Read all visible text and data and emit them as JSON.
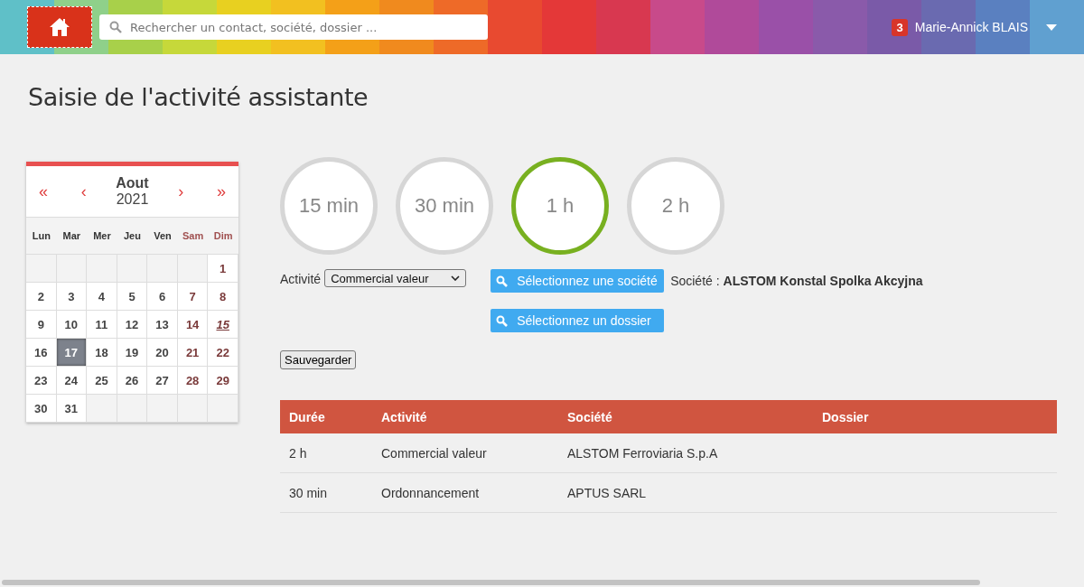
{
  "header": {
    "search": {
      "placeholder": "Rechercher un contact, société, dossier ..."
    },
    "user": {
      "badge": "3",
      "name": "Marie-Annick BLAIS"
    }
  },
  "page_title": "Saisie de l'activité assistante",
  "calendar": {
    "nav": [
      "«",
      "‹",
      "›",
      "»"
    ],
    "month": "Aout",
    "year": "2021",
    "weekdays": [
      {
        "label": "Lun",
        "weekend": false
      },
      {
        "label": "Mar",
        "weekend": false
      },
      {
        "label": "Mer",
        "weekend": false
      },
      {
        "label": "Jeu",
        "weekend": false
      },
      {
        "label": "Ven",
        "weekend": false
      },
      {
        "label": "Sam",
        "weekend": true
      },
      {
        "label": "Dim",
        "weekend": true
      }
    ],
    "weeks": [
      [
        {
          "kind": "empty"
        },
        {
          "kind": "empty"
        },
        {
          "kind": "empty"
        },
        {
          "kind": "empty"
        },
        {
          "kind": "empty"
        },
        {
          "kind": "empty"
        },
        {
          "kind": "day",
          "day": "1",
          "weekend": true,
          "holiday": false,
          "selected": false
        }
      ],
      [
        {
          "kind": "day",
          "day": "2",
          "weekend": false,
          "holiday": false,
          "selected": false
        },
        {
          "kind": "day",
          "day": "3",
          "weekend": false,
          "holiday": false,
          "selected": false
        },
        {
          "kind": "day",
          "day": "4",
          "weekend": false,
          "holiday": false,
          "selected": false
        },
        {
          "kind": "day",
          "day": "5",
          "weekend": false,
          "holiday": false,
          "selected": false
        },
        {
          "kind": "day",
          "day": "6",
          "weekend": false,
          "holiday": false,
          "selected": false
        },
        {
          "kind": "day",
          "day": "7",
          "weekend": true,
          "holiday": false,
          "selected": false
        },
        {
          "kind": "day",
          "day": "8",
          "weekend": true,
          "holiday": false,
          "selected": false
        }
      ],
      [
        {
          "kind": "day",
          "day": "9",
          "weekend": false,
          "holiday": false,
          "selected": false
        },
        {
          "kind": "day",
          "day": "10",
          "weekend": false,
          "holiday": false,
          "selected": false
        },
        {
          "kind": "day",
          "day": "11",
          "weekend": false,
          "holiday": false,
          "selected": false
        },
        {
          "kind": "day",
          "day": "12",
          "weekend": false,
          "holiday": false,
          "selected": false
        },
        {
          "kind": "day",
          "day": "13",
          "weekend": false,
          "holiday": false,
          "selected": false
        },
        {
          "kind": "day",
          "day": "14",
          "weekend": true,
          "holiday": false,
          "selected": false
        },
        {
          "kind": "day",
          "day": "15",
          "weekend": true,
          "holiday": true,
          "selected": false
        }
      ],
      [
        {
          "kind": "day",
          "day": "16",
          "weekend": false,
          "holiday": false,
          "selected": false
        },
        {
          "kind": "day",
          "day": "17",
          "weekend": false,
          "holiday": false,
          "selected": true
        },
        {
          "kind": "day",
          "day": "18",
          "weekend": false,
          "holiday": false,
          "selected": false
        },
        {
          "kind": "day",
          "day": "19",
          "weekend": false,
          "holiday": false,
          "selected": false
        },
        {
          "kind": "day",
          "day": "20",
          "weekend": false,
          "holiday": false,
          "selected": false
        },
        {
          "kind": "day",
          "day": "21",
          "weekend": true,
          "holiday": false,
          "selected": false
        },
        {
          "kind": "day",
          "day": "22",
          "weekend": true,
          "holiday": false,
          "selected": false
        }
      ],
      [
        {
          "kind": "day",
          "day": "23",
          "weekend": false,
          "holiday": false,
          "selected": false
        },
        {
          "kind": "day",
          "day": "24",
          "weekend": false,
          "holiday": false,
          "selected": false
        },
        {
          "kind": "day",
          "day": "25",
          "weekend": false,
          "holiday": false,
          "selected": false
        },
        {
          "kind": "day",
          "day": "26",
          "weekend": false,
          "holiday": false,
          "selected": false
        },
        {
          "kind": "day",
          "day": "27",
          "weekend": false,
          "holiday": false,
          "selected": false
        },
        {
          "kind": "day",
          "day": "28",
          "weekend": true,
          "holiday": false,
          "selected": false
        },
        {
          "kind": "day",
          "day": "29",
          "weekend": true,
          "holiday": false,
          "selected": false
        }
      ],
      [
        {
          "kind": "day",
          "day": "30",
          "weekend": false,
          "holiday": false,
          "selected": false
        },
        {
          "kind": "day",
          "day": "31",
          "weekend": false,
          "holiday": false,
          "selected": false
        },
        {
          "kind": "empty"
        },
        {
          "kind": "empty"
        },
        {
          "kind": "empty"
        },
        {
          "kind": "empty"
        },
        {
          "kind": "empty"
        }
      ]
    ]
  },
  "durations": [
    {
      "label": "15 min",
      "selected": false
    },
    {
      "label": "30 min",
      "selected": false
    },
    {
      "label": "1 h",
      "selected": true
    },
    {
      "label": "2 h",
      "selected": false
    }
  ],
  "form": {
    "activity_label": "Activité",
    "activity_value": "Commercial valeur",
    "company_button": "Sélectionnez une société",
    "company_label": "Société :",
    "company_value": "ALSTOM Konstal Spolka Akcyjna",
    "folder_button": "Sélectionnez un dossier",
    "save_button": "Sauvegarder"
  },
  "table": {
    "columns": [
      "Durée",
      "Activité",
      "Société",
      "Dossier"
    ],
    "rows": [
      [
        "2 h",
        "Commercial valeur",
        "ALSTOM Ferroviaria S.p.A",
        ""
      ],
      [
        "30 min",
        "Ordonnancement",
        "APTUS SARL",
        ""
      ]
    ]
  }
}
